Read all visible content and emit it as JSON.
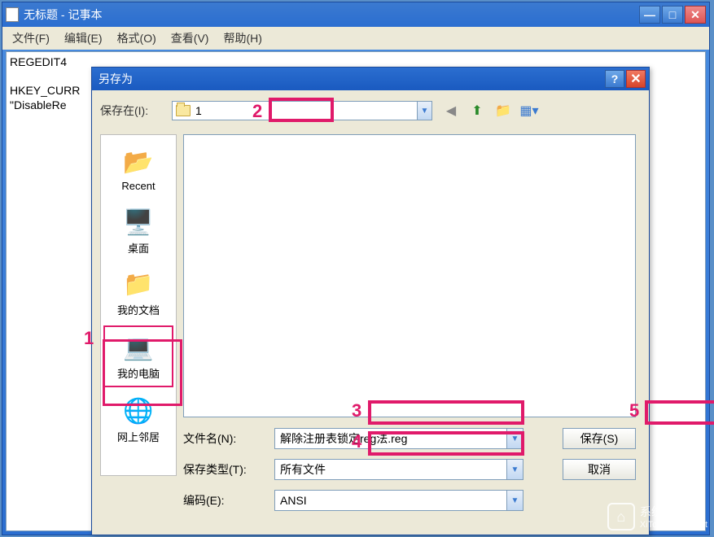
{
  "notepad": {
    "title": "无标题 - 记事本",
    "menu": {
      "file": "文件(F)",
      "edit": "编辑(E)",
      "format": "格式(O)",
      "view": "查看(V)",
      "help": "帮助(H)"
    },
    "content_line1": "REGEDIT4",
    "content_line2": "HKEY_CURR",
    "content_line3": "\"DisableRe"
  },
  "saveas": {
    "title": "另存为",
    "savein_label": "保存在(I):",
    "savein_value": "1",
    "places": {
      "recent": "Recent",
      "desktop": "桌面",
      "documents": "我的文档",
      "computer": "我的电脑",
      "network": "网上邻居"
    },
    "filename_label": "文件名(N):",
    "filename_value": "解除注册表锁定reg法.reg",
    "filetype_label": "保存类型(T):",
    "filetype_value": "所有文件",
    "encoding_label": "编码(E):",
    "encoding_value": "ANSI",
    "save_btn": "保存(S)",
    "cancel_btn": "取消"
  },
  "nav_icons": {
    "back": "back-icon",
    "up": "up-icon",
    "newfolder": "new-folder-icon",
    "views": "views-icon"
  },
  "annotations": {
    "one": "1",
    "two": "2",
    "three": "3",
    "four": "4",
    "five": "5"
  },
  "watermark": {
    "site": "系统之家",
    "url": "XiTongZhiJia.Net"
  }
}
